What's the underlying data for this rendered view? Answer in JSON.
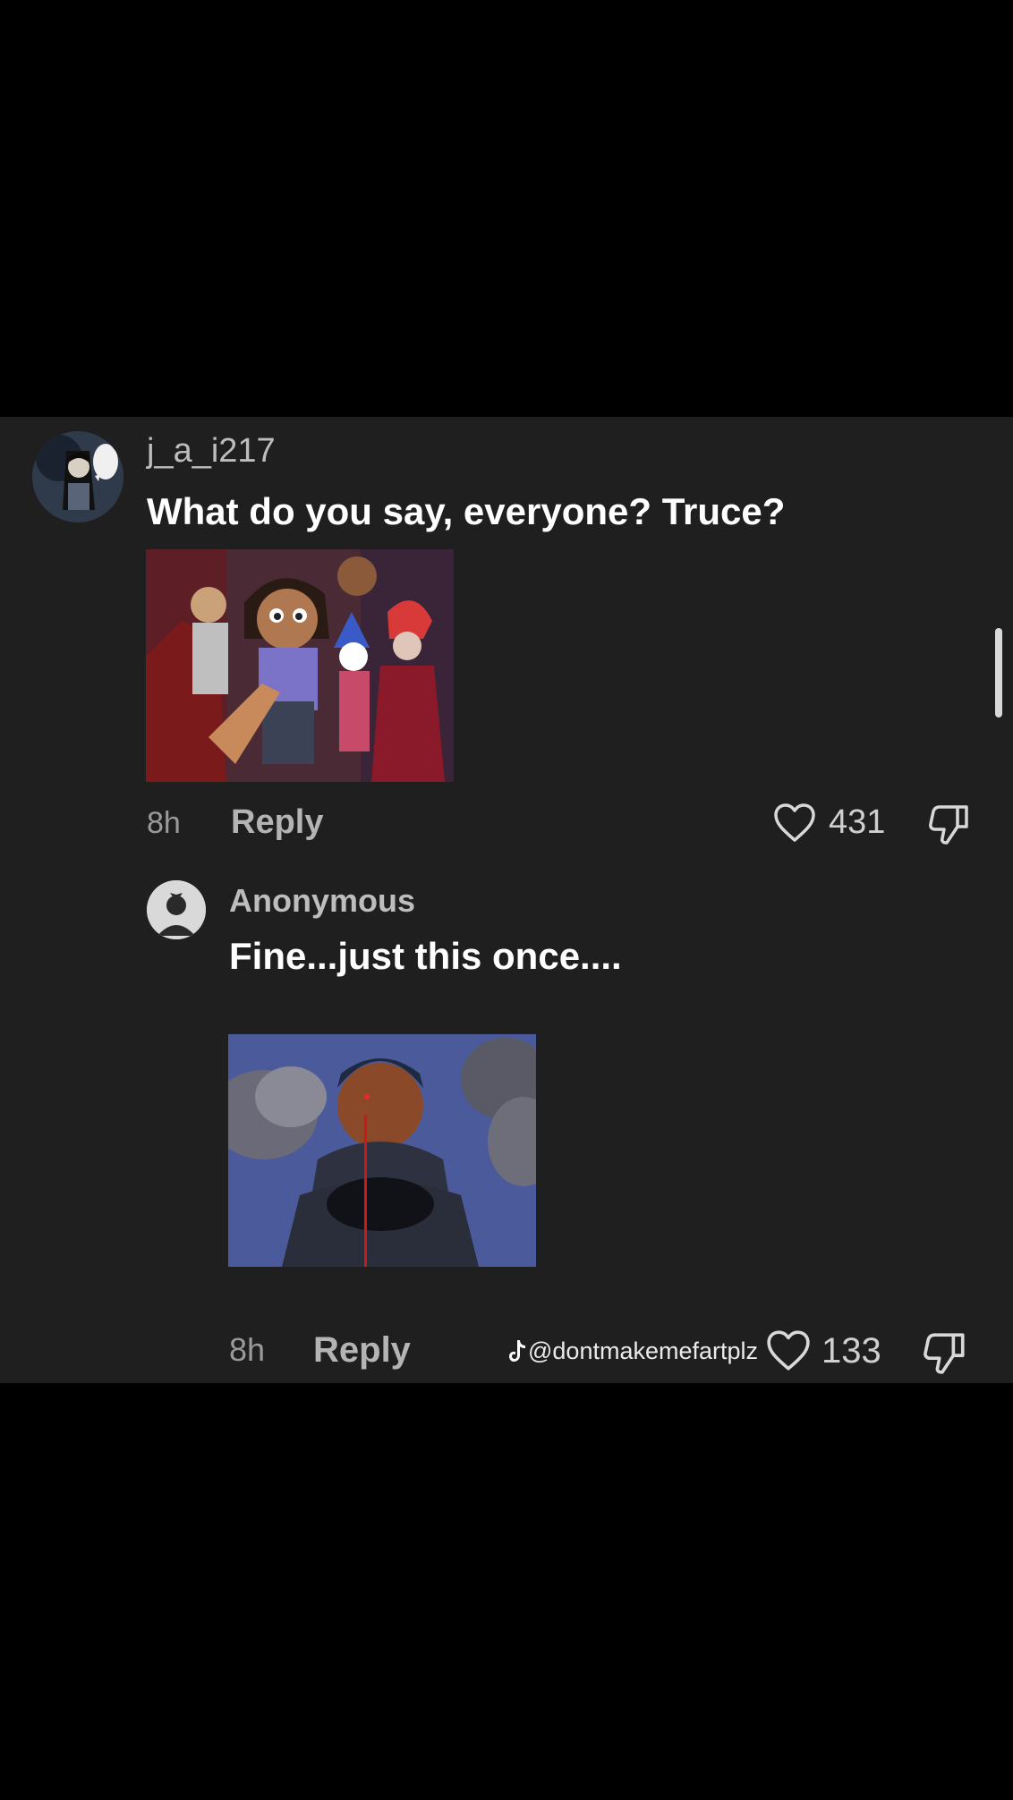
{
  "comment": {
    "username": "j_a_i217",
    "text": "What do you say, everyone? Truce?",
    "time": "8h",
    "reply_label": "Reply",
    "likes": "431"
  },
  "reply": {
    "username": "Anonymous",
    "text": "Fine...just this once....",
    "time": "8h",
    "reply_label": "Reply",
    "likes": "133"
  },
  "watermark": "@dontmakemefartplz",
  "icons": {
    "like": "heart-icon",
    "dislike": "thumbs-down-icon",
    "brand": "tiktok-icon"
  },
  "colors": {
    "panel": "#1f1f1f",
    "background": "#000000",
    "text": "#ffffff",
    "muted": "#9a9a9a"
  }
}
